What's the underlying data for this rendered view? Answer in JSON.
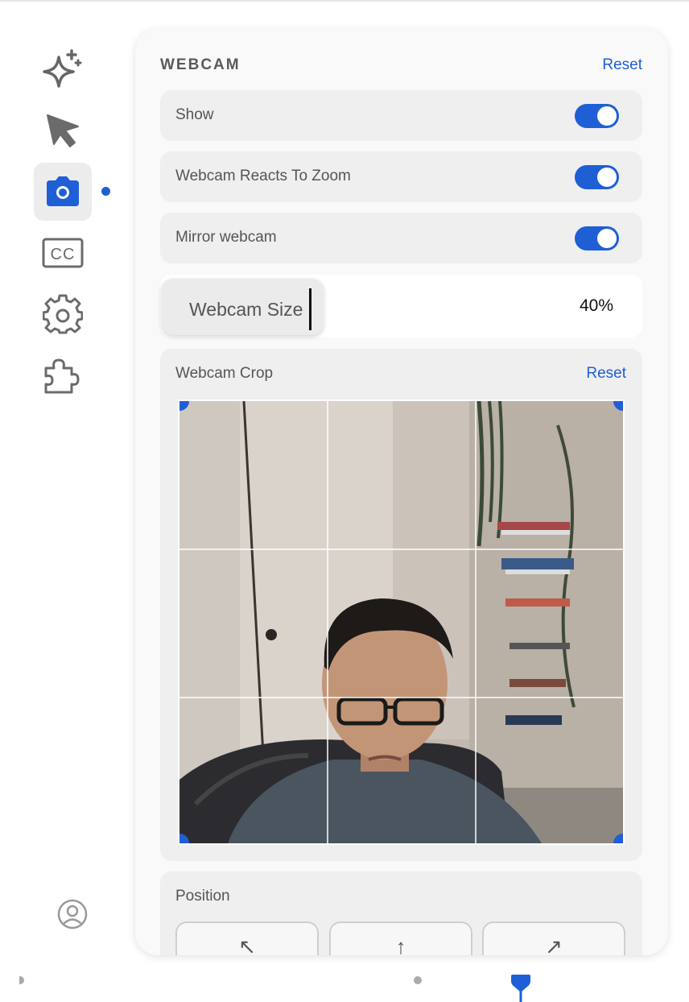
{
  "sidebar": {
    "items": [
      {
        "icon": "sparkles-icon",
        "active": false
      },
      {
        "icon": "cursor-arrow-icon",
        "active": false
      },
      {
        "icon": "camera-icon",
        "active": true
      },
      {
        "icon": "closed-captions-icon",
        "label": "CC",
        "active": false
      },
      {
        "icon": "gear-icon",
        "active": false
      },
      {
        "icon": "puzzle-icon",
        "active": false
      }
    ],
    "profile_icon": "user-circle-icon",
    "accent": "#1f5fd6"
  },
  "panel": {
    "title": "WEBCAM",
    "reset_label": "Reset",
    "toggles": [
      {
        "label": "Show",
        "on": true
      },
      {
        "label": "Webcam Reacts To Zoom",
        "on": true
      },
      {
        "label": "Mirror webcam",
        "on": true
      }
    ],
    "size": {
      "label": "Webcam Size",
      "value": "40%"
    },
    "crop": {
      "label": "Webcam Crop",
      "reset_label": "Reset"
    },
    "position": {
      "label": "Position",
      "buttons": [
        "↖",
        "↑",
        "↗"
      ]
    }
  }
}
